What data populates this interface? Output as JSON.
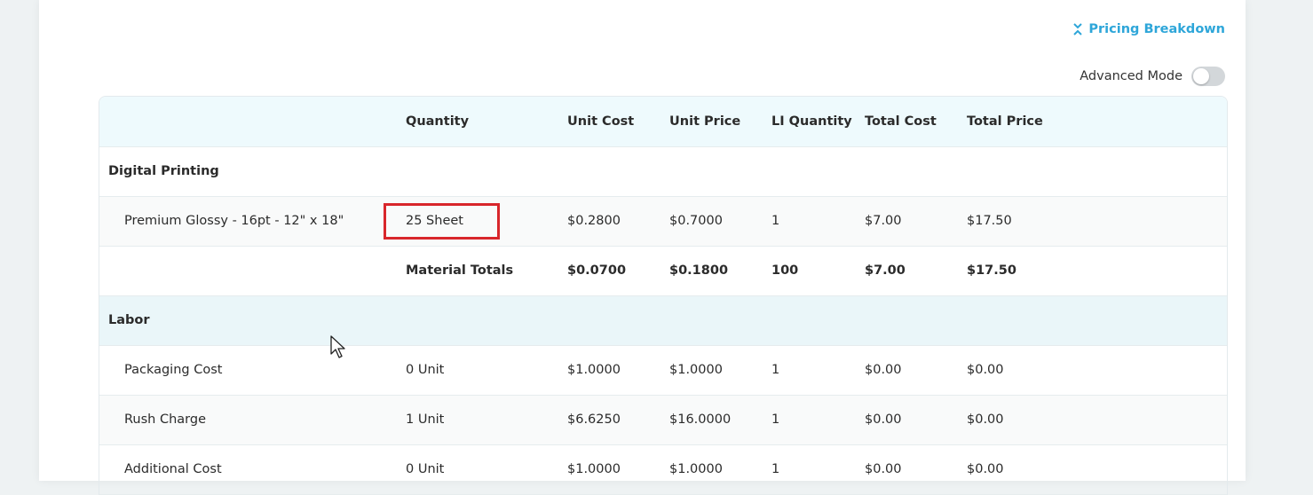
{
  "breakdown_link": {
    "label": "Pricing Breakdown",
    "icon": "collapse-icon",
    "color": "#2ea6d9"
  },
  "advanced_mode": {
    "label": "Advanced Mode",
    "enabled": false
  },
  "table": {
    "headers": [
      "",
      "Quantity",
      "Unit Cost",
      "Unit Price",
      "LI Quantity",
      "Total Cost",
      "Total Price"
    ],
    "sections": [
      {
        "title": "Digital Printing",
        "rows": [
          {
            "name": "Premium Glossy - 16pt - 12\" x 18\"",
            "quantity": "25 Sheet",
            "unit_cost": "$0.2800",
            "unit_price": "$0.7000",
            "li_quantity": "1",
            "total_cost": "$7.00",
            "total_price": "$17.50"
          }
        ],
        "totals": {
          "label": "Material Totals",
          "unit_cost": "$0.0700",
          "unit_price": "$0.1800",
          "li_quantity": "100",
          "total_cost": "$7.00",
          "total_price": "$17.50"
        }
      },
      {
        "title": "Labor",
        "rows": [
          {
            "name": "Packaging Cost",
            "quantity": "0 Unit",
            "unit_cost": "$1.0000",
            "unit_price": "$1.0000",
            "li_quantity": "1",
            "total_cost": "$0.00",
            "total_price": "$0.00"
          },
          {
            "name": "Rush Charge",
            "quantity": "1 Unit",
            "unit_cost": "$6.6250",
            "unit_price": "$16.0000",
            "li_quantity": "1",
            "total_cost": "$0.00",
            "total_price": "$0.00"
          },
          {
            "name": "Additional Cost",
            "quantity": "0 Unit",
            "unit_cost": "$1.0000",
            "unit_price": "$1.0000",
            "li_quantity": "1",
            "total_cost": "$0.00",
            "total_price": "$0.00"
          }
        ]
      }
    ]
  }
}
